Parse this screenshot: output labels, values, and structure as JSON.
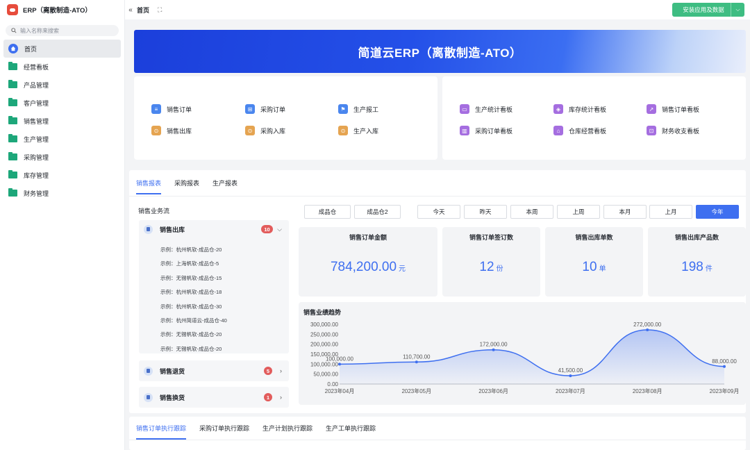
{
  "app": {
    "title": "ERP（离散制造-ATO）"
  },
  "sidebar": {
    "search_placeholder": "输入名称来搜索",
    "items": [
      {
        "label": "首页",
        "icon": "home-icon"
      },
      {
        "label": "经营看板",
        "icon": "folder-icon"
      },
      {
        "label": "产品管理",
        "icon": "folder-icon"
      },
      {
        "label": "客户管理",
        "icon": "folder-icon"
      },
      {
        "label": "销售管理",
        "icon": "folder-icon"
      },
      {
        "label": "生产管理",
        "icon": "folder-icon"
      },
      {
        "label": "采购管理",
        "icon": "folder-icon"
      },
      {
        "label": "库存管理",
        "icon": "folder-icon"
      },
      {
        "label": "财务管理",
        "icon": "folder-icon"
      }
    ]
  },
  "topbar": {
    "collapse_icon": "«",
    "breadcrumb": "首页",
    "expand_icon": "⛶",
    "install_button": "安装应用及数据"
  },
  "banner": {
    "title": "简道云ERP（离散制造-ATO）"
  },
  "shortcuts_left": [
    {
      "label": "销售订单",
      "color": "blue",
      "glyph": "≡"
    },
    {
      "label": "采购订单",
      "color": "blue",
      "glyph": "⊞"
    },
    {
      "label": "生产报工",
      "color": "blue",
      "glyph": "⚑"
    },
    {
      "label": "销售出库",
      "color": "orange",
      "glyph": "⊙"
    },
    {
      "label": "采购入库",
      "color": "orange",
      "glyph": "⊙"
    },
    {
      "label": "生产入库",
      "color": "orange",
      "glyph": "⊙"
    }
  ],
  "shortcuts_right": [
    {
      "label": "生产统计看板",
      "color": "purple",
      "glyph": "▭"
    },
    {
      "label": "库存统计看板",
      "color": "purple",
      "glyph": "◈"
    },
    {
      "label": "销售订单看板",
      "color": "purple",
      "glyph": "↗"
    },
    {
      "label": "采购订单看板",
      "color": "purple",
      "glyph": "▥"
    },
    {
      "label": "仓库经营看板",
      "color": "purple",
      "glyph": "⌂"
    },
    {
      "label": "财务收支看板",
      "color": "purple",
      "glyph": "⊡"
    }
  ],
  "report": {
    "tabs": [
      "销售报表",
      "采购报表",
      "生产报表"
    ],
    "flow_title": "销售业务流",
    "flow": {
      "outbound": {
        "label": "销售出库",
        "count": "10",
        "expanded": true,
        "items": [
          "示例：杭州帆软-成品仓-20",
          "示例：上海帆软-成品仓-5",
          "示例：无锡帆软-成品仓-15",
          "示例：杭州帆软-成品仓-18",
          "示例：杭州帆软-成品仓-30",
          "示例：杭州简道云-成品仓-40",
          "示例：无锡帆软-成品仓-20",
          "示例：无锡帆软-成品仓-20"
        ]
      },
      "returns": {
        "label": "销售退货",
        "count": "5"
      },
      "exchange": {
        "label": "销售换货",
        "count": "1"
      }
    },
    "warehouses": [
      "成品仓",
      "成品仓2"
    ],
    "periods": [
      "今天",
      "昨天",
      "本周",
      "上周",
      "本月",
      "上月",
      "今年"
    ],
    "active_period": "今年",
    "stats": [
      {
        "label": "销售订单金额",
        "value": "784,200.00",
        "unit": "元"
      },
      {
        "label": "销售订单签订数",
        "value": "12",
        "unit": "份"
      },
      {
        "label": "销售出库单数",
        "value": "10",
        "unit": "单"
      },
      {
        "label": "销售出库产品数",
        "value": "198",
        "unit": "件"
      }
    ]
  },
  "chart_data": {
    "type": "area",
    "title": "销售业绩趋势",
    "categories": [
      "2023年04月",
      "2023年05月",
      "2023年06月",
      "2023年07月",
      "2023年08月",
      "2023年09月"
    ],
    "values": [
      100000,
      110700,
      172000,
      41500,
      272000,
      88000
    ],
    "value_labels": [
      "100,000.00",
      "110,700.00",
      "172,000.00",
      "41,500.00",
      "272,000.00",
      "88,000.00"
    ],
    "y_ticks": [
      "300,000.00",
      "250,000.00",
      "200,000.00",
      "150,000.00",
      "100,000.00",
      "50,000.00",
      "0.00"
    ],
    "ylim": [
      0,
      300000
    ],
    "color": "#3e6ff0",
    "smooth": true,
    "grid": false
  },
  "tracking_tabs": [
    "销售订单执行跟踪",
    "采购订单执行跟踪",
    "生产计划执行跟踪",
    "生产工单执行跟踪"
  ]
}
